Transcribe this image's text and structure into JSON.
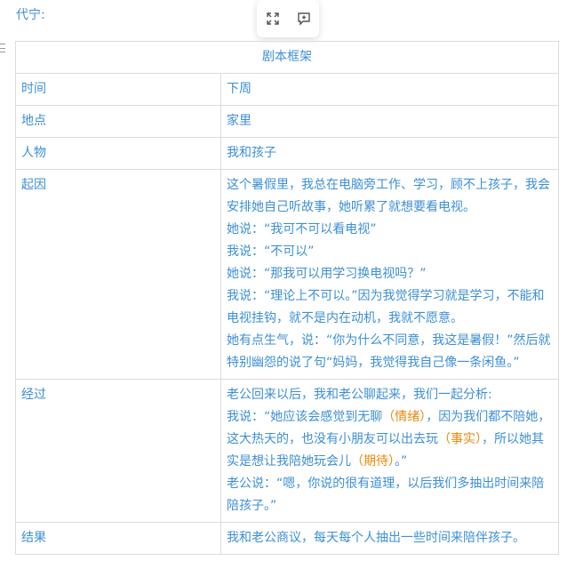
{
  "author_label": "代宁:",
  "toolbar": {
    "expand_icon": "expand-icon",
    "comment_icon": "add-comment-icon"
  },
  "table": {
    "header": "剧本框架",
    "rows": {
      "time": {
        "label": "时间",
        "value": "下周"
      },
      "place": {
        "label": "地点",
        "value": "家里"
      },
      "people": {
        "label": "人物",
        "value": "我和孩子"
      },
      "cause": {
        "label": "起因",
        "lines": [
          "这个暑假里，我总在电脑旁工作、学习，顾不上孩子，我会安排她自己听故事，她听累了就想要看电视。",
          "她说：“我可不可以看电视”",
          "我说：“不可以”",
          "她说：“那我可以用学习换电视吗？”",
          "我说：“理论上不可以。”因为我觉得学习就是学习，不能和电视挂钩，就不是内在动机，我就不愿意。",
          "她有点生气，说：“你为什么不同意，我这是暑假！”然后就特别幽怨的说了句“妈妈，我觉得我自己像一条闲鱼。”"
        ]
      },
      "process": {
        "label": "经过",
        "line1": "老公回来以后，我和老公聊起来，我们一起分析:",
        "line2_a": "我说：“她应该会感觉到无聊",
        "line2_hl1": "（情绪）",
        "line2_b": "，因为我们都不陪她，这大热天的，也没有小朋友可以出去玩",
        "line2_hl2": "（事实）",
        "line2_c": "，所以她其实是想让我陪她玩会儿",
        "line2_hl3": "（期待）",
        "line2_d": "。”",
        "line3": "老公说：“嗯，你说的很有道理，以后我们多抽出时间来陪陪孩子。”"
      },
      "result": {
        "label": "结果",
        "value": "我和老公商议，每天每个人抽出一些时间来陪伴孩子。"
      }
    }
  },
  "colors": {
    "text": "#3d8fd6",
    "highlight": "#e8890c",
    "border": "#dcdcdc"
  }
}
